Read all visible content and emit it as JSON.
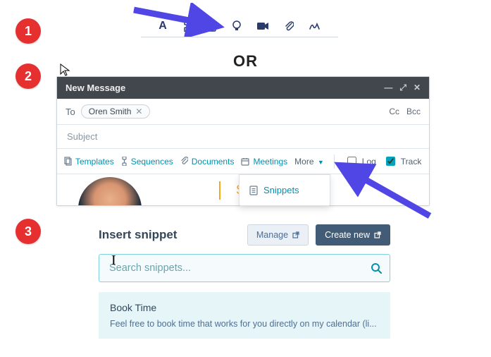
{
  "steps": {
    "one": "1",
    "two": "2",
    "three": "3"
  },
  "or_label": "OR",
  "top_toolbar_icons": [
    "text-format",
    "personalize-token",
    "snippets-icon",
    "knowledge-icon",
    "video-icon",
    "attachment-icon",
    "signature-icon"
  ],
  "compose": {
    "title": "New Message",
    "to_label": "To",
    "recipient": "Oren Smith",
    "cc": "Cc",
    "bcc": "Bcc",
    "subject_placeholder": "Subject",
    "toolbar": {
      "templates": "Templates",
      "sequences": "Sequences",
      "documents": "Documents",
      "meetings": "Meetings",
      "more": "More",
      "log": "Log",
      "track": "Track",
      "log_checked": false,
      "track_checked": true
    },
    "signature_name": "Susan LaP",
    "more_dropdown": {
      "snippets": "Snippets"
    }
  },
  "snippet_panel": {
    "title": "Insert snippet",
    "manage": "Manage",
    "create": "Create new",
    "search_placeholder": "Search snippets...",
    "result": {
      "title": "Book Time",
      "preview": "Feel free to book time that works for you directly on my calendar (li..."
    }
  },
  "colors": {
    "accent": "#0091ae",
    "orange": "#f5a623",
    "arrow": "#4f46e5",
    "badge": "#e63030"
  }
}
